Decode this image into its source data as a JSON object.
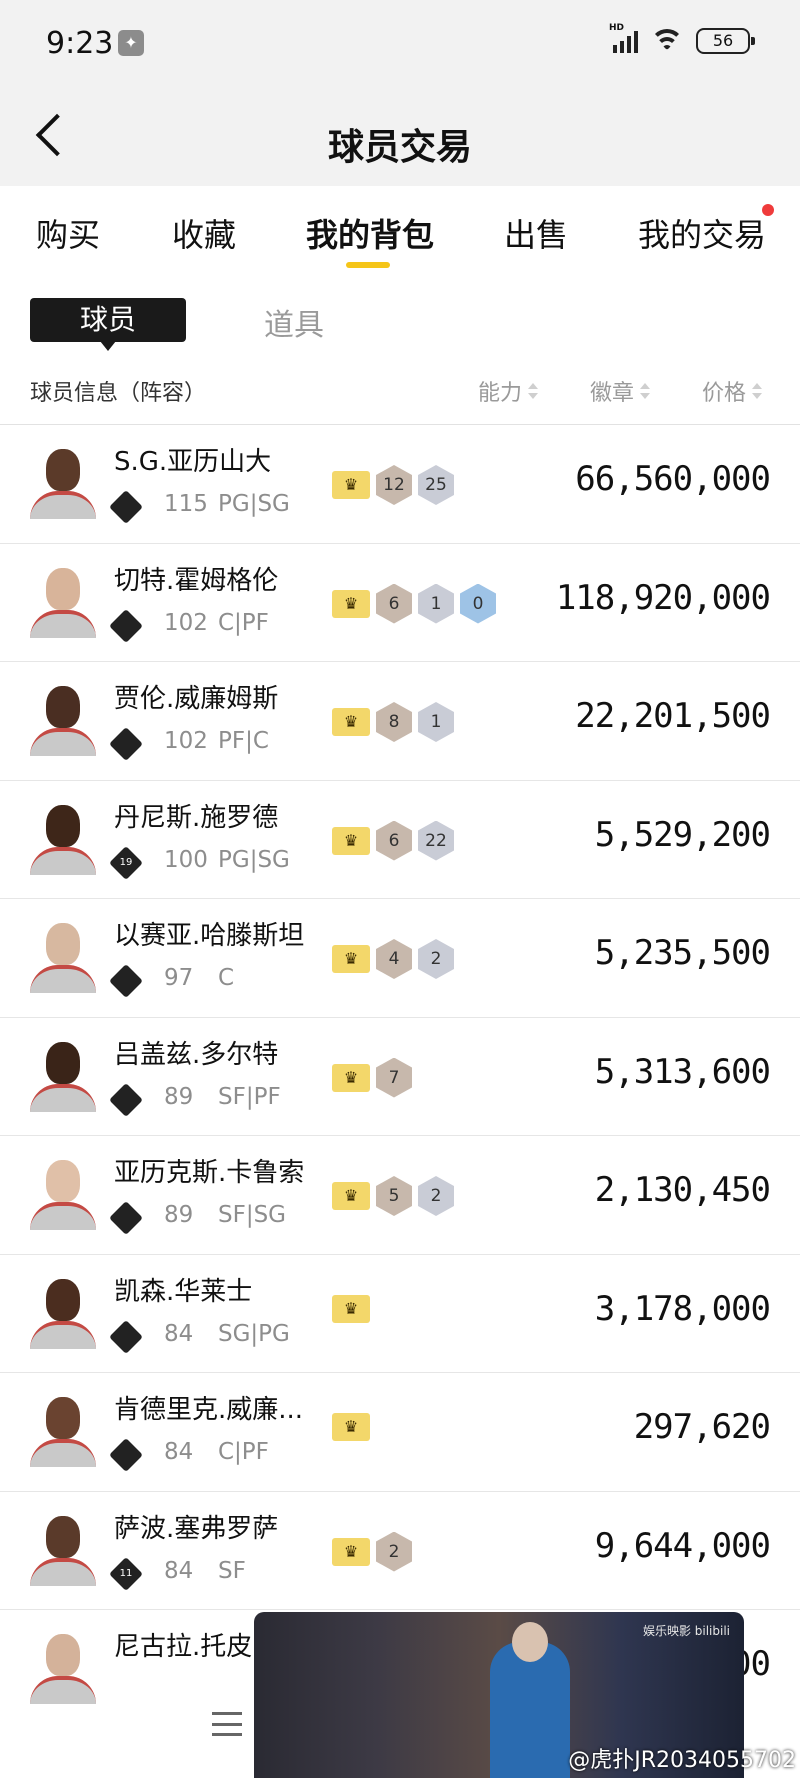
{
  "status_bar": {
    "time": "9:23",
    "battery": "56",
    "network_label": "HD"
  },
  "header": {
    "title": "球员交易"
  },
  "tabs": [
    {
      "label": "购买"
    },
    {
      "label": "收藏"
    },
    {
      "label": "我的背包",
      "active": true
    },
    {
      "label": "出售"
    },
    {
      "label": "我的交易",
      "has_notification": true
    }
  ],
  "subtabs": {
    "active": "球员",
    "inactive": "道具"
  },
  "columns": {
    "info": "球员信息（阵容）",
    "ability": "能力",
    "badge": "徽章",
    "price": "价格"
  },
  "players": [
    {
      "name": "S.G.亚历山大",
      "tier": "",
      "rating": "115",
      "position": "PG|SG",
      "badges": [
        {
          "value": "12",
          "kind": "bronze"
        },
        {
          "value": "25",
          "kind": "silver"
        }
      ],
      "price": "66,560,000"
    },
    {
      "name": "切特.霍姆格伦",
      "tier": "",
      "rating": "102",
      "position": "C|PF",
      "badges": [
        {
          "value": "6",
          "kind": "bronze"
        },
        {
          "value": "1",
          "kind": "silver"
        },
        {
          "value": "0",
          "kind": "blue"
        }
      ],
      "price": "118,920,000"
    },
    {
      "name": "贾伦.威廉姆斯",
      "tier": "",
      "rating": "102",
      "position": "PF|C",
      "badges": [
        {
          "value": "8",
          "kind": "bronze"
        },
        {
          "value": "1",
          "kind": "silver"
        }
      ],
      "price": "22,201,500"
    },
    {
      "name": "丹尼斯.施罗德",
      "tier": "19",
      "rating": "100",
      "position": "PG|SG",
      "badges": [
        {
          "value": "6",
          "kind": "bronze"
        },
        {
          "value": "22",
          "kind": "silver"
        }
      ],
      "price": "5,529,200"
    },
    {
      "name": "以赛亚.哈滕斯坦",
      "tier": "",
      "rating": "97",
      "position": "C",
      "badges": [
        {
          "value": "4",
          "kind": "bronze"
        },
        {
          "value": "2",
          "kind": "silver"
        }
      ],
      "price": "5,235,500"
    },
    {
      "name": "吕盖兹.多尔特",
      "tier": "",
      "rating": "89",
      "position": "SF|PF",
      "badges": [
        {
          "value": "7",
          "kind": "bronze"
        }
      ],
      "price": "5,313,600"
    },
    {
      "name": "亚历克斯.卡鲁索",
      "tier": "",
      "rating": "89",
      "position": "SF|SG",
      "badges": [
        {
          "value": "5",
          "kind": "bronze"
        },
        {
          "value": "2",
          "kind": "silver"
        }
      ],
      "price": "2,130,450"
    },
    {
      "name": "凯森.华莱士",
      "tier": "",
      "rating": "84",
      "position": "SG|PG",
      "badges": [],
      "price": "3,178,000"
    },
    {
      "name": "肯德里克.威廉...",
      "tier": "",
      "rating": "84",
      "position": "C|PF",
      "badges": [],
      "price": "297,620"
    },
    {
      "name": "萨波.塞弗罗萨",
      "tier": "11",
      "rating": "84",
      "position": "SF",
      "badges": [
        {
          "value": "2",
          "kind": "bronze"
        }
      ],
      "price": "9,644,000"
    },
    {
      "name": "尼古拉.托皮",
      "tier": "",
      "rating": "",
      "position": "",
      "badges": [],
      "price": "00"
    }
  ],
  "video": {
    "logo_text": "娱乐映影 bilibili"
  },
  "watermark": "@虎扑JR2034055702",
  "colors": {
    "accent_yellow": "#f5c518",
    "notification_red": "#ef3b3b",
    "active_subtab_bg": "#1a1a1a"
  }
}
